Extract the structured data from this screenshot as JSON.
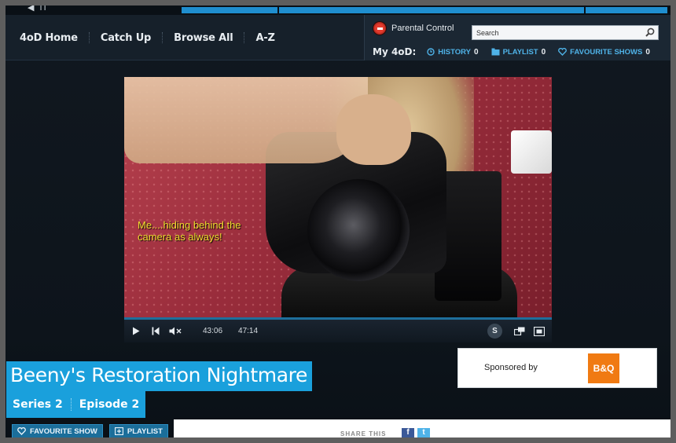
{
  "topstrip": {
    "glyph": "◀ ıı"
  },
  "nav": {
    "items": [
      {
        "label": "4oD Home"
      },
      {
        "label": "Catch Up"
      },
      {
        "label": "Browse All"
      },
      {
        "label": "A-Z"
      }
    ]
  },
  "parental": {
    "label": "Parental Control"
  },
  "search": {
    "placeholder": "Search"
  },
  "my4od": {
    "title": "My 4oD:",
    "history": {
      "label": "HISTORY",
      "count": "0"
    },
    "playlist": {
      "label": "PLAYLIST",
      "count": "0"
    },
    "favourites": {
      "label": "FAVOURITE SHOWS",
      "count": "0"
    }
  },
  "player": {
    "caption_line1": "Me....hiding behind the",
    "caption_line2": "camera as always!",
    "current_time": "43:06",
    "total_time": "47:14",
    "subtitles_label": "S"
  },
  "show": {
    "title": "Beeny's Restoration Nightmare",
    "series": "Series 2",
    "episode": "Episode 2"
  },
  "sponsor": {
    "label": "Sponsored by",
    "logo_text": "B&Q"
  },
  "actions": {
    "favourite_label": "FAVOURITE SHOW",
    "playlist_label": "PLAYLIST"
  },
  "share": {
    "label": "SHARE THIS",
    "facebook": "f",
    "twitter": "t"
  },
  "colors": {
    "accent": "#1aa0dc",
    "link": "#4fb3e8",
    "sponsor_orange": "#f07a12"
  }
}
